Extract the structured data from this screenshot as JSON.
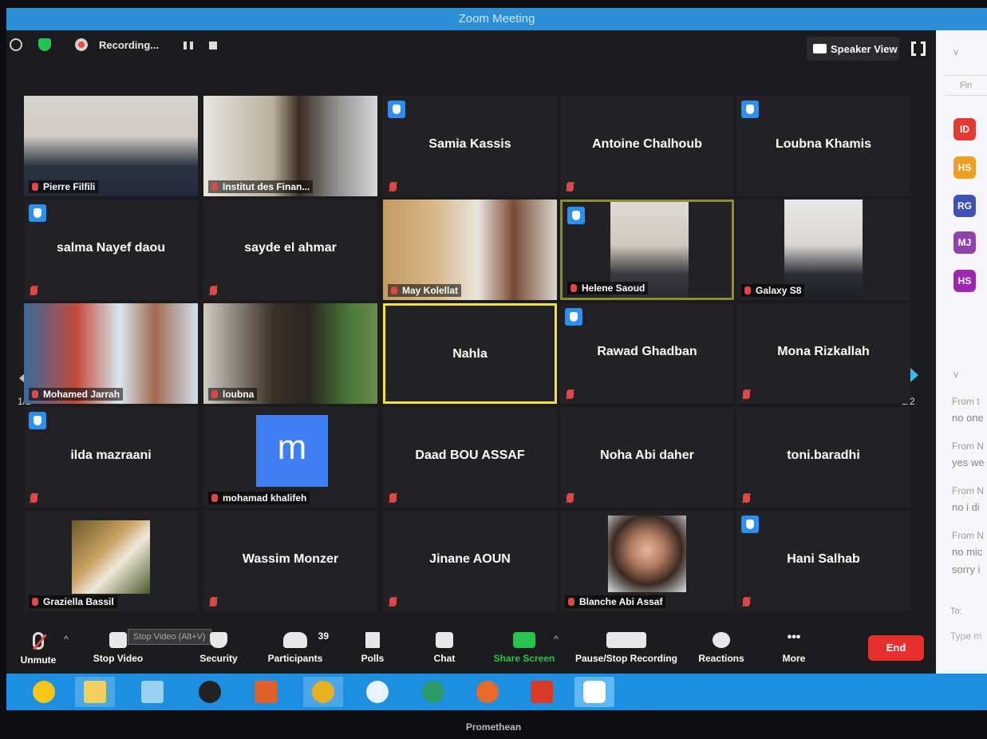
{
  "window": {
    "title": "Zoom Meeting"
  },
  "topbar": {
    "recording_label": "Recording...",
    "speaker_view_label": "Speaker View"
  },
  "pagination": {
    "left": "1/2",
    "right": "1/2"
  },
  "tiles": {
    "pierre": "Pierre Filfili",
    "institut": "Institut des Finan...",
    "samia": "Samia Kassis",
    "antoine": "Antoine Chalhoub",
    "loubna_k": "Loubna Khamis",
    "salma": "salma Nayef daou",
    "sayde": "sayde el ahmar",
    "may": "May Kolellat",
    "helene": "Helene Saoud",
    "galaxy": "Galaxy S8",
    "mohamed": "Mohamed Jarrah",
    "loubna": "loubna",
    "nahla": "Nahla",
    "rawad": "Rawad Ghadban",
    "mona": "Mona Rizkallah",
    "ilda": "ilda mazraani",
    "mohamad_avatar": "m",
    "mohamad": "mohamad khalifeh",
    "daad": "Daad BOU ASSAF",
    "noha": "Noha Abi daher",
    "toni": "toni.baradhi",
    "graziella": "Graziella Bassil",
    "wassim": "Wassim Monzer",
    "jinane": "Jinane AOUN",
    "blanche": "Blanche Abi Assaf",
    "hani": "Hani Salhab"
  },
  "toolbar": {
    "unmute": "Unmute",
    "stop_video": "Stop Video",
    "stop_video_tooltip": "Stop Video (Alt+V)",
    "security": "Security",
    "participants": "Participants",
    "participants_count": "39",
    "polls": "Polls",
    "chat": "Chat",
    "share_screen": "Share Screen",
    "pause_stop_recording": "Pause/Stop Recording",
    "reactions": "Reactions",
    "more": "More",
    "end": "End"
  },
  "sidebar": {
    "search_placeholder": "Fin",
    "avatars": [
      {
        "initials": "ID",
        "color": "#e53935"
      },
      {
        "initials": "HS",
        "color": "#f0a020"
      },
      {
        "initials": "RG",
        "color": "#3f51b5"
      },
      {
        "initials": "MJ",
        "color": "#8e44ad"
      },
      {
        "initials": "HS",
        "color": "#9c27b0"
      }
    ],
    "chat": [
      {
        "from": "From t",
        "msg": "no one"
      },
      {
        "from": "From N",
        "msg": "yes we"
      },
      {
        "from": "From N",
        "msg": "no i di"
      },
      {
        "from": "From N",
        "msg": "no mic"
      }
    ],
    "chat_extra": "sorry i",
    "to_label": "To:",
    "input_placeholder": "Type m"
  },
  "footer": {
    "brand": "Promethean"
  },
  "colors": {
    "accent": "#2d8ff0",
    "end": "#e5302d",
    "share": "#28c24e",
    "active_speaker": "#f0e33c"
  }
}
